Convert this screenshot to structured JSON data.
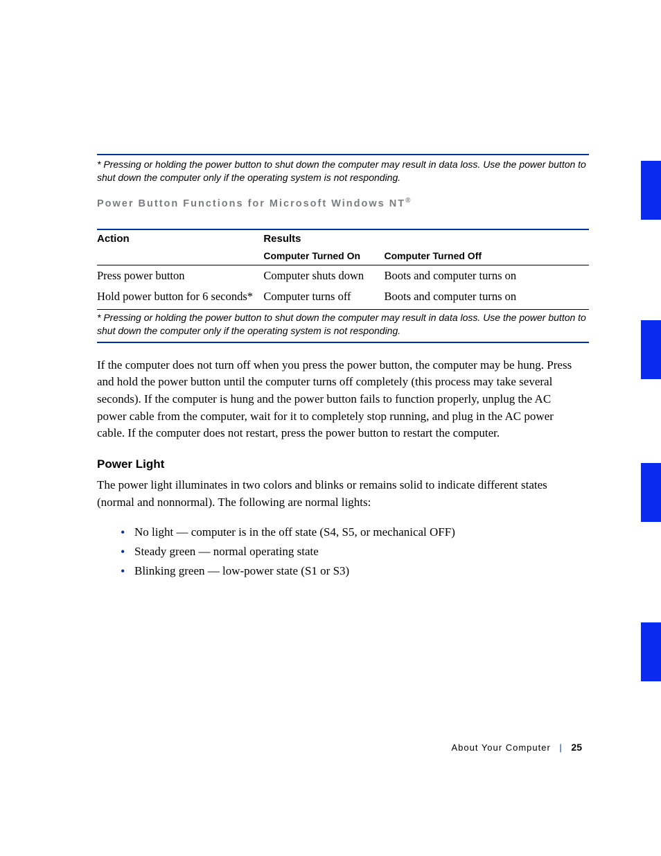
{
  "footnote1": "* Pressing or holding the power button to shut down the computer may result in data loss. Use the power button to shut down the computer only if the operating system is not responding.",
  "table": {
    "title_prefix": "Power Button Functions for Microsoft Windows NT",
    "title_sup": "®",
    "headers": {
      "action": "Action",
      "results": "Results",
      "on": "Computer Turned On",
      "off": "Computer Turned Off"
    },
    "rows": [
      {
        "action": "Press power button",
        "on": "Computer shuts down",
        "off": "Boots and computer turns on"
      },
      {
        "action": "Hold power button for 6 seconds*",
        "on": "Computer turns off",
        "off": "Boots and computer turns on"
      }
    ]
  },
  "footnote2": "* Pressing or holding the power button to shut down the computer may result in data loss. Use the power button to shut down the computer only if the operating system is not responding.",
  "paragraph": "If the computer does not turn off when you press the power button, the computer may be hung. Press and hold the power button until the computer turns off completely (this process may take several seconds). If the computer is hung and the power button fails to function properly, unplug the AC power cable from the computer, wait for it to completely stop running, and plug in the AC power cable. If the computer does not restart, press the power button to restart the computer.",
  "section_title": "Power Light",
  "section_intro": "The power light illuminates in two colors and blinks or remains solid to indicate different states (normal and nonnormal). The following are normal lights:",
  "bullets": [
    "No light — computer is in the off state (S4, S5, or mechanical OFF)",
    "Steady green — normal operating state",
    "Blinking green — low-power state (S1 or S3)"
  ],
  "footer": {
    "section": "About Your Computer",
    "page": "25"
  }
}
